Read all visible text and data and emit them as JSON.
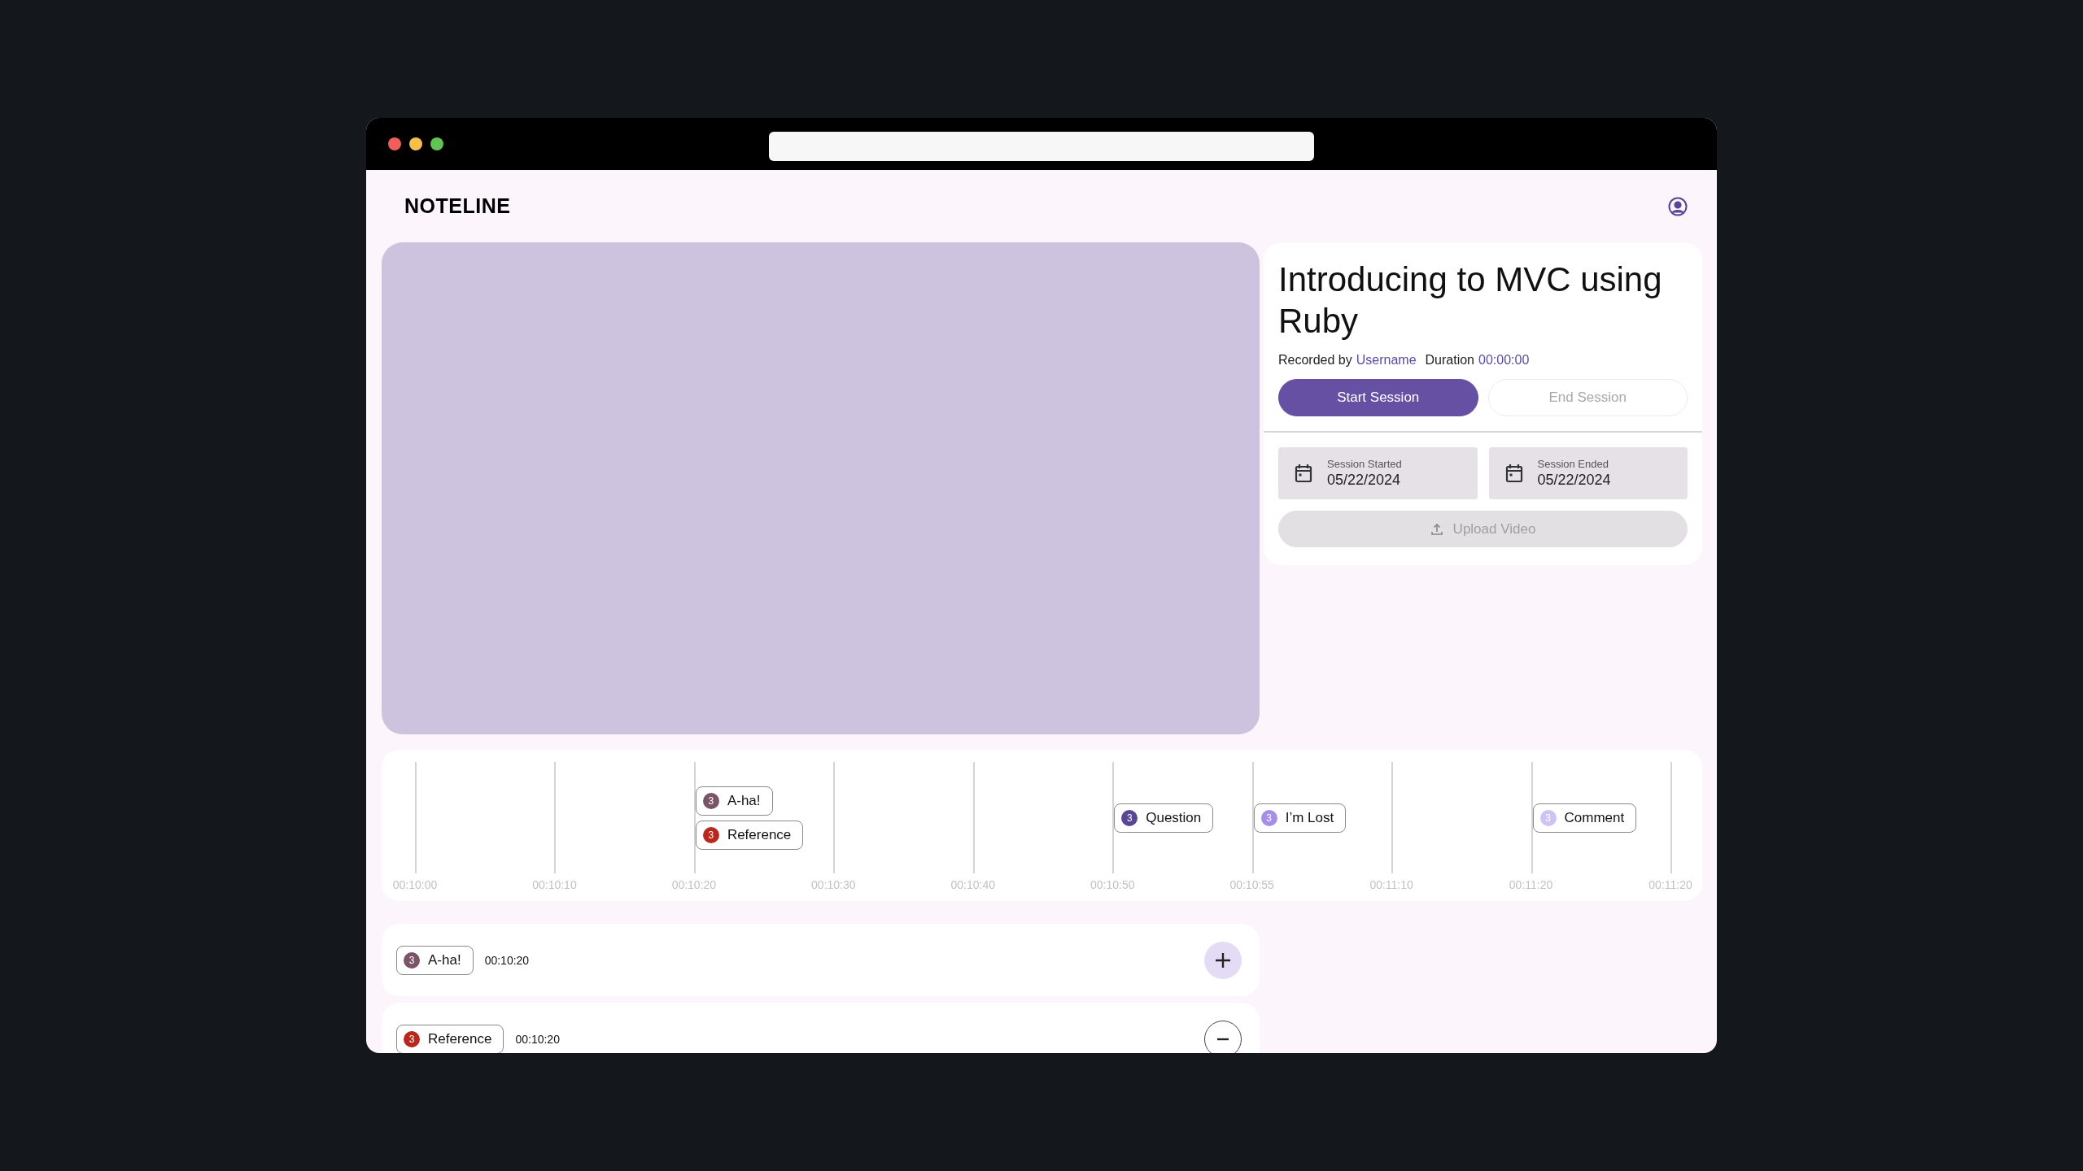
{
  "app": {
    "logo": "NOTELINE"
  },
  "session": {
    "title": "Introducing to MVC using Ruby",
    "recorded_by_label": "Recorded by",
    "username": "Username",
    "duration_label": "Duration",
    "duration": "00:00:00",
    "buttons": [
      {
        "label": "Start Session",
        "kind": "primary",
        "disabled": false
      },
      {
        "label": "End Session",
        "kind": "secondary",
        "disabled": true
      }
    ],
    "dates": [
      {
        "label": "Session Started",
        "value": "05/22/2024"
      },
      {
        "label": "Session Ended",
        "value": "05/22/2024"
      }
    ],
    "upload": {
      "label": "Upload Video",
      "disabled": true
    }
  },
  "timeline": {
    "ticks": [
      {
        "label": "00:10:00"
      },
      {
        "label": "00:10:10"
      },
      {
        "label": "00:10:20",
        "markers": [
          {
            "label": "A-ha!",
            "count": "3",
            "color": "#7a5468"
          },
          {
            "label": "Reference",
            "count": "3",
            "color": "#b8281f"
          }
        ]
      },
      {
        "label": "00:10:30"
      },
      {
        "label": "00:10:40"
      },
      {
        "label": "00:10:50",
        "markers": [
          {
            "label": "Question",
            "count": "3",
            "color": "#5a4496"
          }
        ]
      },
      {
        "label": "00:10:55",
        "markers": [
          {
            "label": "I’m Lost",
            "count": "3",
            "color": "#a58fe6"
          }
        ]
      },
      {
        "label": "00:11:10"
      },
      {
        "label": "00:11:20",
        "markers": [
          {
            "label": "Comment",
            "count": "3",
            "color": "#cfc3f5"
          }
        ]
      },
      {
        "label": "00:11:20"
      }
    ]
  },
  "notes": [
    {
      "tag": {
        "label": "A-ha!",
        "count": "3",
        "color": "#7a5468"
      },
      "time": "00:10:20",
      "kind": "add"
    },
    {
      "tag": {
        "label": "Reference",
        "count": "3",
        "color": "#b8281f"
      },
      "time": "00:10:20",
      "kind": "remove"
    }
  ]
}
